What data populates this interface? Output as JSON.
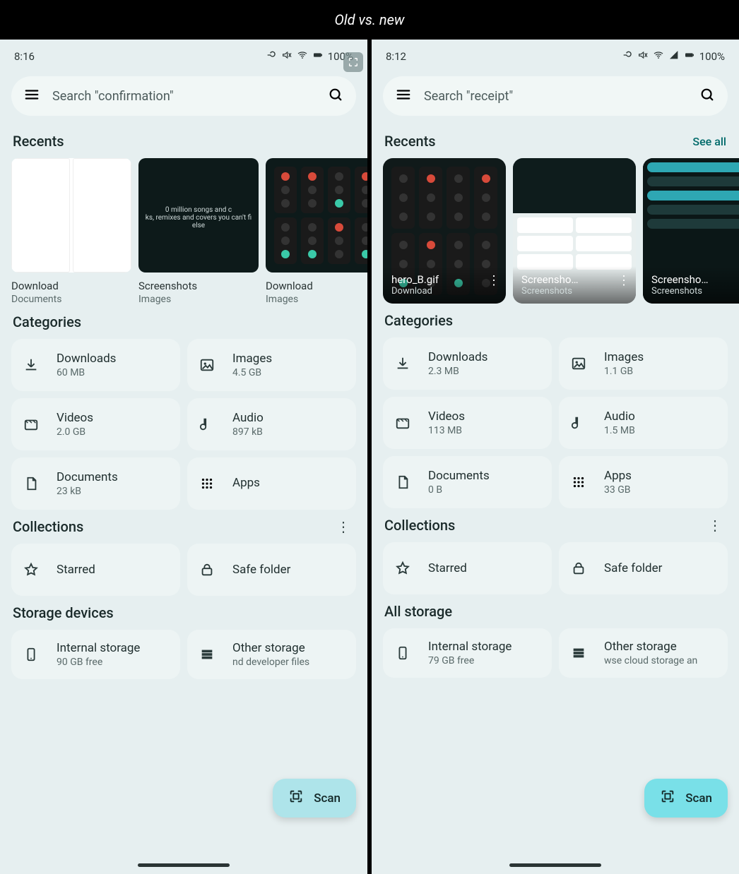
{
  "header": "Old vs. new",
  "left": {
    "status": {
      "time": "8:16",
      "battery": "100%"
    },
    "search": {
      "placeholder": "Search \"confirmation\""
    },
    "sections": {
      "recents": "Recents",
      "categories": "Categories",
      "collections": "Collections",
      "storage": "Storage devices"
    },
    "recents": [
      {
        "name": "Download",
        "sub": "Documents"
      },
      {
        "name": "Screenshots",
        "sub": "Images"
      },
      {
        "name": "Download",
        "sub": "Images"
      }
    ],
    "categories": [
      {
        "icon": "download",
        "label": "Downloads",
        "sub": "60 MB"
      },
      {
        "icon": "image",
        "label": "Images",
        "sub": "4.5 GB"
      },
      {
        "icon": "video",
        "label": "Videos",
        "sub": "2.0 GB"
      },
      {
        "icon": "audio",
        "label": "Audio",
        "sub": "897 kB"
      },
      {
        "icon": "document",
        "label": "Documents",
        "sub": "23 kB"
      },
      {
        "icon": "apps",
        "label": "Apps",
        "sub": ""
      }
    ],
    "collections": [
      {
        "icon": "star",
        "label": "Starred"
      },
      {
        "icon": "lock",
        "label": "Safe folder"
      }
    ],
    "storage": [
      {
        "icon": "phone",
        "label": "Internal storage",
        "sub": "90 GB free"
      },
      {
        "icon": "storage",
        "label": "Other storage",
        "sub": "nd developer files"
      }
    ],
    "scan": "Scan"
  },
  "right": {
    "status": {
      "time": "8:12",
      "battery": "100%"
    },
    "search": {
      "placeholder": "Search \"receipt\""
    },
    "sections": {
      "recents": "Recents",
      "see_all": "See all",
      "categories": "Categories",
      "collections": "Collections",
      "storage": "All storage"
    },
    "recents": [
      {
        "name": "hero_B.gif",
        "sub": "Download"
      },
      {
        "name": "Screensho…",
        "sub": "Screenshots"
      },
      {
        "name": "Screensho…",
        "sub": "Screenshots"
      }
    ],
    "categories": [
      {
        "icon": "download",
        "label": "Downloads",
        "sub": "2.3 MB"
      },
      {
        "icon": "image",
        "label": "Images",
        "sub": "1.1 GB"
      },
      {
        "icon": "video",
        "label": "Videos",
        "sub": "113 MB"
      },
      {
        "icon": "audio",
        "label": "Audio",
        "sub": "1.5 MB"
      },
      {
        "icon": "document",
        "label": "Documents",
        "sub": "0 B"
      },
      {
        "icon": "apps",
        "label": "Apps",
        "sub": "33 GB"
      }
    ],
    "collections": [
      {
        "icon": "star",
        "label": "Starred"
      },
      {
        "icon": "lock",
        "label": "Safe folder"
      }
    ],
    "storage": [
      {
        "icon": "phone",
        "label": "Internal storage",
        "sub": "79 GB free"
      },
      {
        "icon": "storage",
        "label": "Other storage",
        "sub": "wse cloud storage an"
      }
    ],
    "scan": "Scan"
  }
}
